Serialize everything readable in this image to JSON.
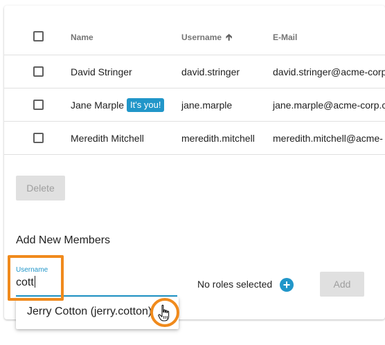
{
  "table": {
    "headers": {
      "name": "Name",
      "username": "Username",
      "email": "E-Mail"
    },
    "sort_icon": "arrow-up-icon",
    "rows": [
      {
        "name": "David Stringer",
        "badge": "",
        "username": "david.stringer",
        "email": "david.stringer@acme-corp"
      },
      {
        "name": "Jane Marple",
        "badge": "It's you!",
        "username": "jane.marple",
        "email": "jane.marple@acme-corp.c"
      },
      {
        "name": "Meredith Mitchell",
        "badge": "",
        "username": "meredith.mitchell",
        "email": "meredith.mitchell@acme-"
      }
    ]
  },
  "actions": {
    "delete_label": "Delete"
  },
  "add_members": {
    "title": "Add New Members",
    "username_label": "Username",
    "username_value": "cott",
    "roles_text": "No roles selected",
    "add_role_icon": "plus-circle-icon",
    "add_label": "Add",
    "suggestion": "Jerry Cotton (jerry.cotton)"
  },
  "colors": {
    "accent": "#2196c9",
    "highlight": "#f08a1c",
    "disabled_bg": "#e0e0e0"
  }
}
